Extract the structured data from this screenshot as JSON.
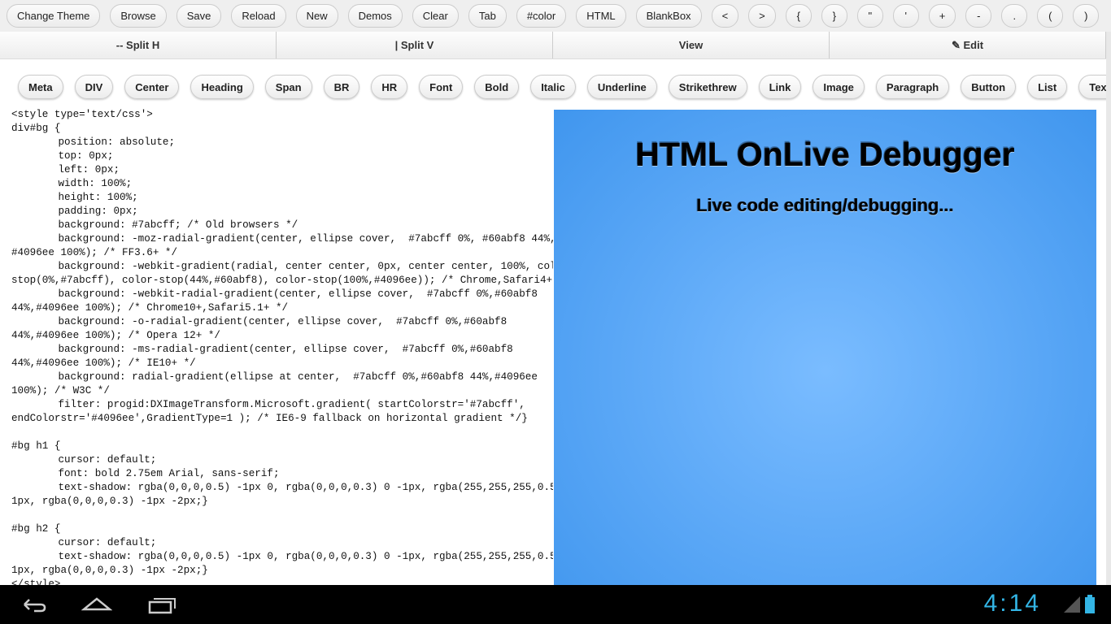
{
  "toolbar": [
    "Change Theme",
    "Browse",
    "Save",
    "Reload",
    "New",
    "Demos",
    "Clear",
    "Tab",
    "#color",
    "HTML",
    "BlankBox",
    "<",
    ">",
    "{",
    "}",
    "\"",
    "'",
    "+",
    "-",
    ".",
    "(",
    ")"
  ],
  "tabs": [
    {
      "label": "-- Split H"
    },
    {
      "label": "| Split V"
    },
    {
      "label": "View"
    },
    {
      "label": "✎ Edit",
      "icon": "pencil-icon"
    }
  ],
  "tags": [
    "Meta",
    "DIV",
    "Center",
    "Heading",
    "Span",
    "BR",
    "HR",
    "Font",
    "Bold",
    "Italic",
    "Underline",
    "Strikethrew",
    "Link",
    "Image",
    "Paragraph",
    "Button",
    "List",
    "Text Input"
  ],
  "code": "<style type='text/css'>\ndiv#bg {\n\tposition: absolute;\n\ttop: 0px;\n\tleft: 0px;\n\twidth: 100%;\n\theight: 100%;\n\tpadding: 0px;\n\tbackground: #7abcff; /* Old browsers */\n\tbackground: -moz-radial-gradient(center, ellipse cover,  #7abcff 0%, #60abf8 44%,\n#4096ee 100%); /* FF3.6+ */\n\tbackground: -webkit-gradient(radial, center center, 0px, center center, 100%, color-\nstop(0%,#7abcff), color-stop(44%,#60abf8), color-stop(100%,#4096ee)); /* Chrome,Safari4+ */\n\tbackground: -webkit-radial-gradient(center, ellipse cover,  #7abcff 0%,#60abf8\n44%,#4096ee 100%); /* Chrome10+,Safari5.1+ */\n\tbackground: -o-radial-gradient(center, ellipse cover,  #7abcff 0%,#60abf8\n44%,#4096ee 100%); /* Opera 12+ */\n\tbackground: -ms-radial-gradient(center, ellipse cover,  #7abcff 0%,#60abf8\n44%,#4096ee 100%); /* IE10+ */\n\tbackground: radial-gradient(ellipse at center,  #7abcff 0%,#60abf8 44%,#4096ee\n100%); /* W3C */\n\tfilter: progid:DXImageTransform.Microsoft.gradient( startColorstr='#7abcff',\nendColorstr='#4096ee',GradientType=1 ); /* IE6-9 fallback on horizontal gradient */}\n\n#bg h1 {\n\tcursor: default;\n\tfont: bold 2.75em Arial, sans-serif;\n\ttext-shadow: rgba(0,0,0,0.5) -1px 0, rgba(0,0,0,0.3) 0 -1px, rgba(255,255,255,0.5) 0\n1px, rgba(0,0,0,0.3) -1px -2px;}\n\n#bg h2 {\n\tcursor: default;\n\ttext-shadow: rgba(0,0,0,0.5) -1px 0, rgba(0,0,0,0.3) 0 -1px, rgba(255,255,255,0.5) 0\n1px, rgba(0,0,0,0.3) -1px -2px;}\n</style>",
  "preview": {
    "h1": "HTML OnLive Debugger",
    "h2": "Live code editing/debugging...",
    "colors": [
      "#7abcff",
      "#60abf8",
      "#4096ee"
    ]
  },
  "status": {
    "clock": "4:14",
    "accent": "#33b5e5"
  }
}
